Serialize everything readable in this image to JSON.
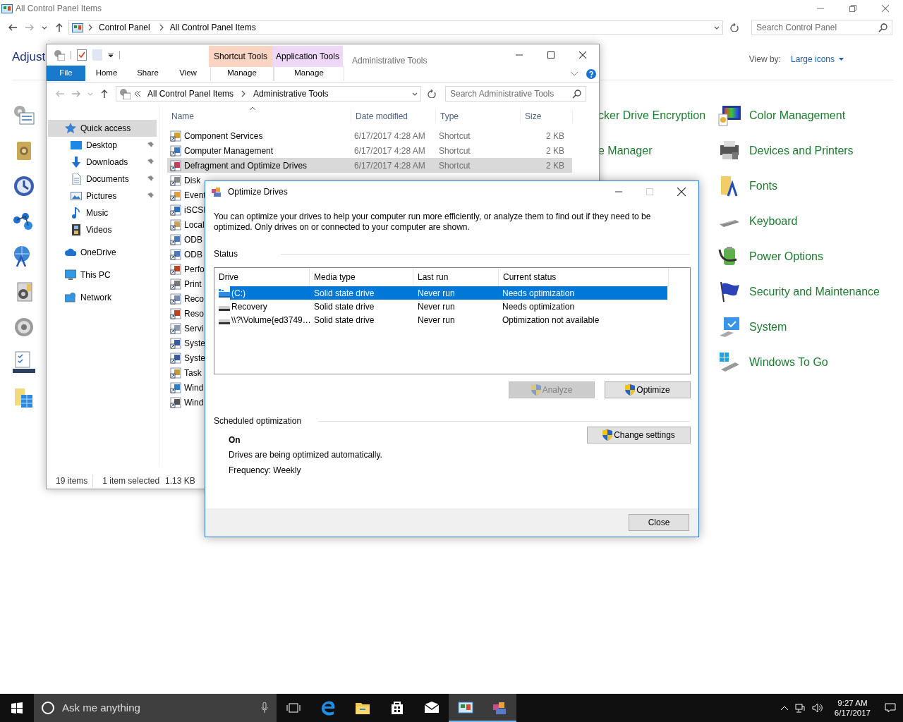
{
  "control_panel": {
    "title": "All Control Panel Items",
    "address": [
      "Control Panel",
      "All Control Panel Items"
    ],
    "search": {
      "placeholder": "Search Control Panel"
    },
    "heading": "Adjust",
    "view_by": {
      "label": "View by:",
      "value": "Large icons"
    },
    "middle_items": [
      "cker Drive Encryption",
      "e Manager"
    ],
    "right_items": [
      "Color Management",
      "Devices and Printers",
      "Fonts",
      "Keyboard",
      "Power Options",
      "Security and Maintenance",
      "System",
      "Windows To Go"
    ]
  },
  "explorer": {
    "title": "Administrative Tools",
    "context_tabs": [
      {
        "label": "Shortcut Tools",
        "tab": "Manage",
        "color": "#fbd5c3"
      },
      {
        "label": "Application Tools",
        "tab": "Manage",
        "color": "#efd7f7"
      }
    ],
    "ribbon_tabs": [
      {
        "label": "File",
        "kind": "file"
      },
      {
        "label": "Home",
        "kind": "tab"
      },
      {
        "label": "Share",
        "kind": "tab"
      },
      {
        "label": "View",
        "kind": "tab"
      }
    ],
    "address": [
      "All Control Panel Items",
      "Administrative Tools"
    ],
    "search": {
      "placeholder": "Search Administrative Tools"
    },
    "nav": [
      {
        "label": "Quick access",
        "kind": "group",
        "selected": true,
        "pinned": false
      },
      {
        "label": "Desktop",
        "kind": "child",
        "selected": false,
        "pinned": true
      },
      {
        "label": "Downloads",
        "kind": "child",
        "selected": false,
        "pinned": true
      },
      {
        "label": "Documents",
        "kind": "child",
        "selected": false,
        "pinned": true
      },
      {
        "label": "Pictures",
        "kind": "child",
        "selected": false,
        "pinned": true
      },
      {
        "label": "Music",
        "kind": "child",
        "selected": false,
        "pinned": false
      },
      {
        "label": "Videos",
        "kind": "child",
        "selected": false,
        "pinned": false
      },
      {
        "label": "OneDrive",
        "kind": "group",
        "selected": false,
        "pinned": false
      },
      {
        "label": "This PC",
        "kind": "group",
        "selected": false,
        "pinned": false
      },
      {
        "label": "Network",
        "kind": "group",
        "selected": false,
        "pinned": false
      }
    ],
    "columns": [
      "Name",
      "Date modified",
      "Type",
      "Size"
    ],
    "files": [
      {
        "name": "Component Services",
        "date": "6/17/2017 4:28 AM",
        "type": "Shortcut",
        "size": "2 KB",
        "selected": false
      },
      {
        "name": "Computer Management",
        "date": "6/17/2017 4:28 AM",
        "type": "Shortcut",
        "size": "2 KB",
        "selected": false
      },
      {
        "name": "Defragment and Optimize Drives",
        "date": "6/17/2017 4:28 AM",
        "type": "Shortcut",
        "size": "2 KB",
        "selected": true
      },
      {
        "name": "Disk",
        "selected": false
      },
      {
        "name": "Event",
        "selected": false
      },
      {
        "name": "iSCSI",
        "selected": false
      },
      {
        "name": "Local",
        "selected": false
      },
      {
        "name": "ODB",
        "selected": false
      },
      {
        "name": "ODB",
        "selected": false
      },
      {
        "name": "Perfo",
        "selected": false
      },
      {
        "name": "Print",
        "selected": false
      },
      {
        "name": "Reco",
        "selected": false
      },
      {
        "name": "Reso",
        "selected": false
      },
      {
        "name": "Servi",
        "selected": false
      },
      {
        "name": "Syste",
        "selected": false
      },
      {
        "name": "Syste",
        "selected": false
      },
      {
        "name": "Task",
        "selected": false
      },
      {
        "name": "Wind",
        "selected": false
      },
      {
        "name": "Wind",
        "selected": false
      }
    ],
    "status": [
      "19 items",
      "1 item selected",
      "1.13 KB"
    ]
  },
  "dialog": {
    "title": "Optimize Drives",
    "description": "You can optimize your drives to help your computer run more efficiently, or analyze them to find out if they need to be optimized. Only drives on or connected to your computer are shown.",
    "status_heading": "Status",
    "columns": [
      "Drive",
      "Media type",
      "Last run",
      "Current status"
    ],
    "drives": [
      {
        "drive": "(C:)",
        "media": "Solid state drive",
        "last_run": "Never run",
        "status": "Needs optimization",
        "kind": "system",
        "selected": true
      },
      {
        "drive": "Recovery",
        "media": "Solid state drive",
        "last_run": "Never run",
        "status": "Needs optimization",
        "kind": "disk",
        "selected": false
      },
      {
        "drive": "\\\\?\\Volume{ed3749…",
        "media": "Solid state drive",
        "last_run": "Never run",
        "status": "Optimization not available",
        "kind": "disk",
        "selected": false
      }
    ],
    "buttons": [
      {
        "label": "Analyze",
        "disabled": true
      },
      {
        "label": "Optimize",
        "disabled": false
      }
    ],
    "schedule": {
      "heading": "Scheduled optimization",
      "state": "On",
      "description": "Drives are being optimized automatically.",
      "frequency": "Frequency: Weekly",
      "button": "Change settings"
    },
    "close": "Close"
  },
  "taskbar": {
    "search": {
      "placeholder": "Ask me anything"
    },
    "apps": [
      {
        "active": false
      },
      {
        "active": false
      },
      {
        "active": false
      },
      {
        "active": false
      },
      {
        "active": true
      },
      {
        "active": true
      }
    ],
    "clock": {
      "time": "9:27 AM",
      "date": "6/17/2017"
    }
  }
}
